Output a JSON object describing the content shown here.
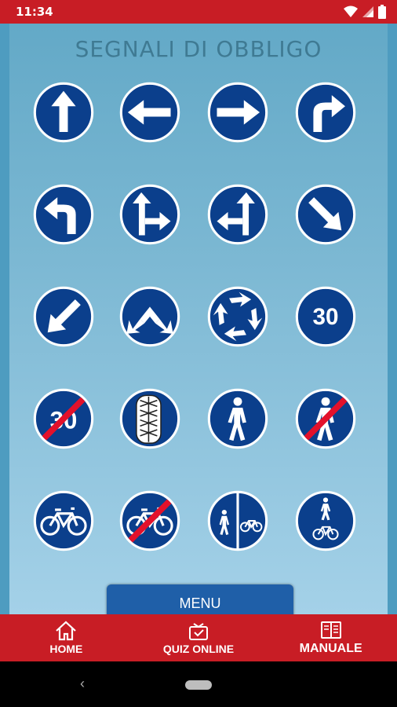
{
  "status": {
    "time": "11:34"
  },
  "page": {
    "title": "SEGNALI DI OBBLIGO"
  },
  "signs": [
    {
      "name": "sign-straight-ahead"
    },
    {
      "name": "sign-turn-left"
    },
    {
      "name": "sign-turn-right"
    },
    {
      "name": "sign-turn-right-ahead"
    },
    {
      "name": "sign-turn-left-ahead"
    },
    {
      "name": "sign-straight-or-right"
    },
    {
      "name": "sign-straight-or-left"
    },
    {
      "name": "sign-keep-right"
    },
    {
      "name": "sign-keep-left"
    },
    {
      "name": "sign-pass-either-side"
    },
    {
      "name": "sign-roundabout"
    },
    {
      "name": "sign-minimum-speed-30"
    },
    {
      "name": "sign-end-minimum-speed-30"
    },
    {
      "name": "sign-snow-chains"
    },
    {
      "name": "sign-pedestrian-path"
    },
    {
      "name": "sign-end-pedestrian-path"
    },
    {
      "name": "sign-cycle-path"
    },
    {
      "name": "sign-end-cycle-path"
    },
    {
      "name": "sign-split-pedestrian-cycle"
    },
    {
      "name": "sign-shared-pedestrian-cycle"
    }
  ],
  "speed_value": "30",
  "menu_button": {
    "label": "MENU"
  },
  "bottom_nav": {
    "home": "HOME",
    "quiz": "QUIZ ONLINE",
    "manual": "MANUALE"
  },
  "colors": {
    "brand_red": "#c81d25",
    "sign_blue": "#0b3f8c",
    "sign_border": "#ffffff"
  }
}
